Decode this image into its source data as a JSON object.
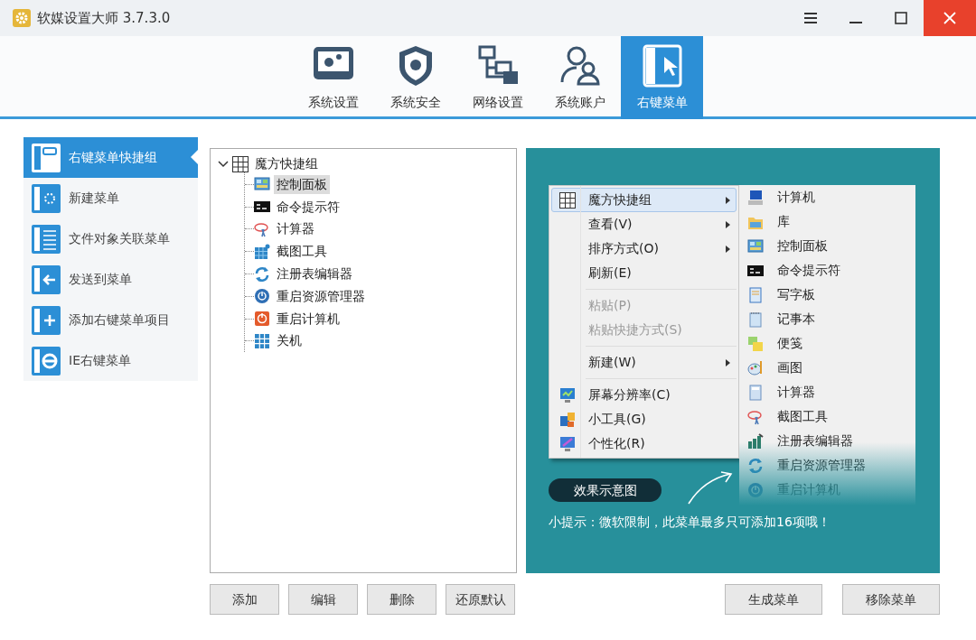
{
  "window": {
    "title": "软媒设置大师 3.7.3.0"
  },
  "tabs": [
    {
      "label": "系统设置",
      "selected": false
    },
    {
      "label": "系统安全",
      "selected": false
    },
    {
      "label": "网络设置",
      "selected": false
    },
    {
      "label": "系统账户",
      "selected": false
    },
    {
      "label": "右键菜单",
      "selected": true
    }
  ],
  "sidebar": {
    "items": [
      {
        "label": "右键菜单快捷组",
        "selected": true
      },
      {
        "label": "新建菜单",
        "selected": false
      },
      {
        "label": "文件对象关联菜单",
        "selected": false
      },
      {
        "label": "发送到菜单",
        "selected": false
      },
      {
        "label": "添加右键菜单项目",
        "selected": false
      },
      {
        "label": "IE右键菜单",
        "selected": false
      }
    ]
  },
  "tree": {
    "label": "魔方快捷组",
    "expanded": true,
    "children": [
      {
        "label": "控制面板",
        "selected": true
      },
      {
        "label": "命令提示符",
        "selected": false
      },
      {
        "label": "计算器",
        "selected": false
      },
      {
        "label": "截图工具",
        "selected": false
      },
      {
        "label": "注册表编辑器",
        "selected": false
      },
      {
        "label": "重启资源管理器",
        "selected": false
      },
      {
        "label": "重启计算机",
        "selected": false
      },
      {
        "label": "关机",
        "selected": false
      }
    ]
  },
  "preview": {
    "context_menu": [
      {
        "kind": "item",
        "label": "魔方快捷组",
        "submenu": true,
        "disabled": false,
        "selected": true
      },
      {
        "kind": "item",
        "label": "查看(V)",
        "submenu": true,
        "disabled": false,
        "selected": false
      },
      {
        "kind": "item",
        "label": "排序方式(O)",
        "submenu": true,
        "disabled": false,
        "selected": false
      },
      {
        "kind": "item",
        "label": "刷新(E)",
        "submenu": false,
        "disabled": false,
        "selected": false
      },
      {
        "kind": "separator"
      },
      {
        "kind": "item",
        "label": "粘贴(P)",
        "submenu": false,
        "disabled": true,
        "selected": false
      },
      {
        "kind": "item",
        "label": "粘贴快捷方式(S)",
        "submenu": false,
        "disabled": true,
        "selected": false
      },
      {
        "kind": "separator"
      },
      {
        "kind": "item",
        "label": "新建(W)",
        "submenu": true,
        "disabled": false,
        "selected": false
      },
      {
        "kind": "separator"
      },
      {
        "kind": "item",
        "label": "屏幕分辨率(C)",
        "submenu": false,
        "disabled": false,
        "selected": false
      },
      {
        "kind": "item",
        "label": "小工具(G)",
        "submenu": false,
        "disabled": false,
        "selected": false
      },
      {
        "kind": "item",
        "label": "个性化(R)",
        "submenu": false,
        "disabled": false,
        "selected": false
      }
    ],
    "submenu": [
      "计算机",
      "库",
      "控制面板",
      "命令提示符",
      "写字板",
      "记事本",
      "便笺",
      "画图",
      "计算器",
      "截图工具",
      "注册表编辑器",
      "重启资源管理器",
      "重启计算机"
    ],
    "badge": "效果示意图",
    "tip": "小提示：微软限制，此菜单最多只可添加16项哦！"
  },
  "tree_buttons": [
    "添加",
    "编辑",
    "删除",
    "还原默认"
  ],
  "action_buttons": [
    "生成菜单",
    "移除菜单"
  ]
}
